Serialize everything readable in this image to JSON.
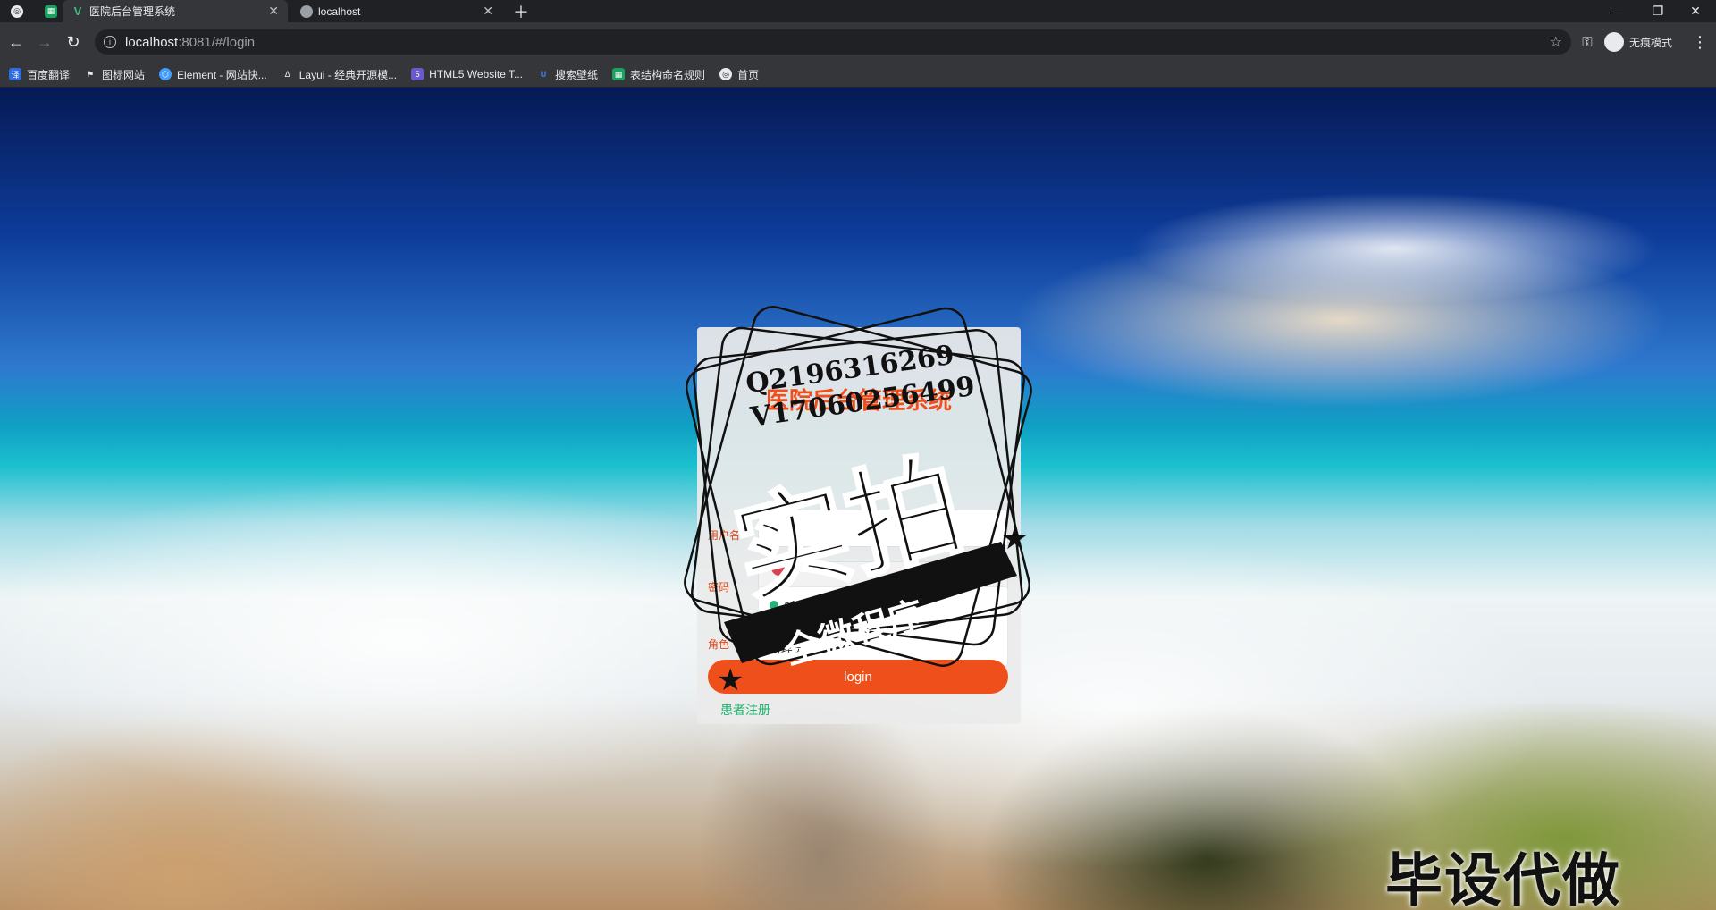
{
  "browser": {
    "tabs": [
      {
        "title": "医院后台管理系统",
        "active": true
      },
      {
        "title": "localhost",
        "active": false
      }
    ],
    "url_host": "localhost",
    "url_path": ":8081/#/login",
    "incognito_label": "无痕模式",
    "bookmarks": [
      {
        "label": "百度翻译",
        "color": "#2e6be6"
      },
      {
        "label": "图标网站",
        "color": "#e8eaed"
      },
      {
        "label": "Element - 网站快...",
        "color": "#409eff"
      },
      {
        "label": "Layui - 经典开源模...",
        "color": "#e8eaed"
      },
      {
        "label": "HTML5 Website T...",
        "color": "#6a5acd"
      },
      {
        "label": "搜索壁纸",
        "color": "#3b82f6"
      },
      {
        "label": "表结构命名规则",
        "color": "#1aa260"
      },
      {
        "label": "首页",
        "color": "#e8eaed"
      }
    ]
  },
  "login": {
    "title": "医院后台管理系统",
    "username_label": "用户名",
    "password_label": "密码",
    "role_label": "角色",
    "role_options": [
      "a1",
      "管理员"
    ],
    "submit_label": "login",
    "register_link": "患者注册"
  },
  "watermark": {
    "qq": "Q2196316269",
    "wechat": "V17060256499",
    "stamp_main": "实拍",
    "stamp_banner": "全微程序",
    "corner_text": "毕设代做"
  },
  "colors": {
    "accent": "#ef4f1a",
    "link": "#1bb570"
  }
}
